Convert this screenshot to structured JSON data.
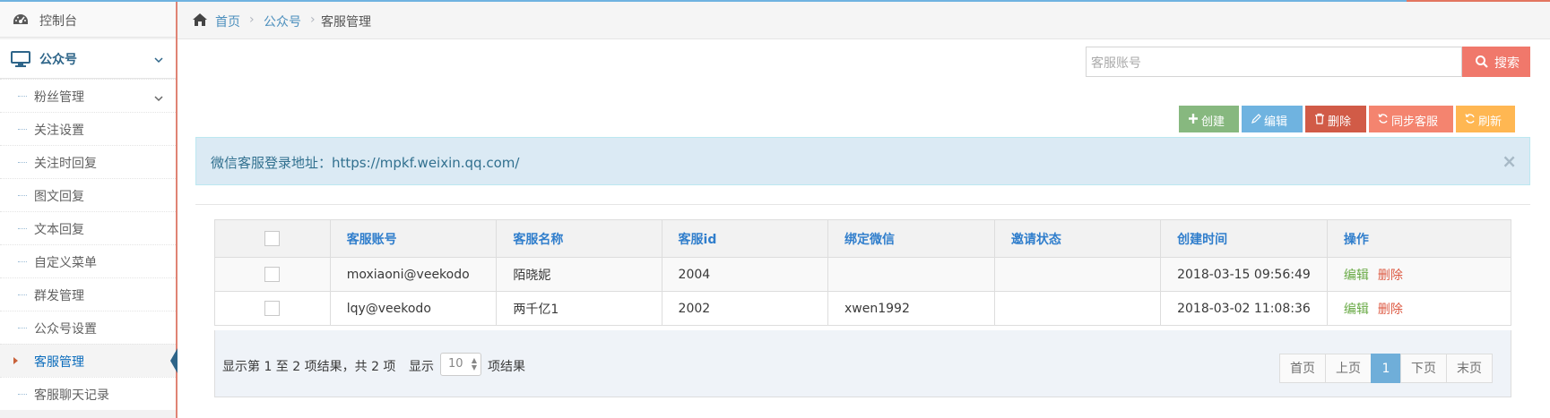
{
  "sidebar": {
    "top_item": {
      "label": "控制台",
      "icon": "dashboard-icon"
    },
    "open_item": {
      "label": "公众号",
      "icon": "desktop-icon"
    },
    "sub_items": [
      {
        "label": "粉丝管理",
        "has_children": true
      },
      {
        "label": "关注设置"
      },
      {
        "label": "关注时回复"
      },
      {
        "label": "图文回复"
      },
      {
        "label": "文本回复"
      },
      {
        "label": "自定义菜单"
      },
      {
        "label": "群发管理"
      },
      {
        "label": "公众号设置"
      },
      {
        "label": "客服管理",
        "active": true
      },
      {
        "label": "客服聊天记录"
      }
    ]
  },
  "breadcrumb": {
    "home": "首页",
    "section": "公众号",
    "current": "客服管理"
  },
  "search": {
    "placeholder": "客服账号",
    "button_label": "搜索"
  },
  "toolbar": {
    "create": "创建",
    "edit": "编辑",
    "delete": "删除",
    "sync": "同步客服",
    "refresh": "刷新"
  },
  "colors": {
    "create": "#87b87f",
    "edit": "#6fb3e0",
    "delete": "#d15b47",
    "sync": "#f4846f",
    "refresh": "#ffb752",
    "search": "#f0786b"
  },
  "alert": {
    "text": "微信客服登录地址：https://mpkf.weixin.qq.com/",
    "close": "×"
  },
  "table": {
    "columns": [
      "客服账号",
      "客服名称",
      "客服id",
      "绑定微信",
      "邀请状态",
      "创建时间",
      "操作"
    ],
    "rows": [
      {
        "account": "moxiaoni@veekodo",
        "name": "陌晓妮",
        "id": "2004",
        "wechat": "",
        "invite": "",
        "created": "2018-03-15 09:56:49"
      },
      {
        "account": "lqy@veekodo",
        "name": "两千亿1",
        "id": "2002",
        "wechat": "xwen1992",
        "invite": "",
        "created": "2018-03-02 11:08:36"
      }
    ],
    "row_actions": {
      "edit": "编辑",
      "delete": "删除"
    }
  },
  "footer": {
    "info": "显示第 1 至 2 项结果，共 2 项",
    "show_label": "显示",
    "page_size": "10",
    "results_label": "项结果"
  },
  "pagination": {
    "first": "首页",
    "prev": "上页",
    "current": "1",
    "next": "下页",
    "last": "末页"
  }
}
